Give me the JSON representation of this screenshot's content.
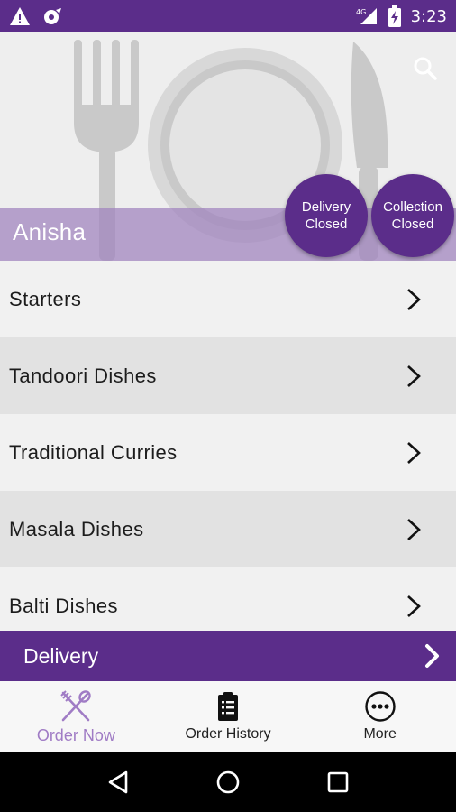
{
  "status_bar": {
    "time": "3:23",
    "network": "4G",
    "icons": [
      "warning-icon",
      "tomato-icon",
      "signal-icon",
      "battery-charging-icon"
    ],
    "background": "#5b2d8a"
  },
  "header": {
    "restaurant_name": "Anisha",
    "search_icon": "search-icon",
    "delivery_status": {
      "line1": "Delivery",
      "line2": "Closed"
    },
    "collection_status": {
      "line1": "Collection",
      "line2": "Closed"
    }
  },
  "menu": {
    "categories": [
      {
        "label": "Starters"
      },
      {
        "label": "Tandoori Dishes"
      },
      {
        "label": "Traditional Curries"
      },
      {
        "label": "Masala Dishes"
      },
      {
        "label": "Balti Dishes"
      }
    ]
  },
  "order_bar": {
    "label": "Delivery"
  },
  "bottom_nav": {
    "items": [
      {
        "label": "Order Now",
        "icon": "fork-spoon-icon",
        "active": true
      },
      {
        "label": "Order History",
        "icon": "clipboard-icon",
        "active": false
      },
      {
        "label": "More",
        "icon": "more-dots-icon",
        "active": false
      }
    ]
  },
  "colors": {
    "brand_purple": "#5b2d8a",
    "accent_lilac": "#a07cc5",
    "row_light": "#f1f1f1",
    "row_dark": "#e2e2e2"
  }
}
